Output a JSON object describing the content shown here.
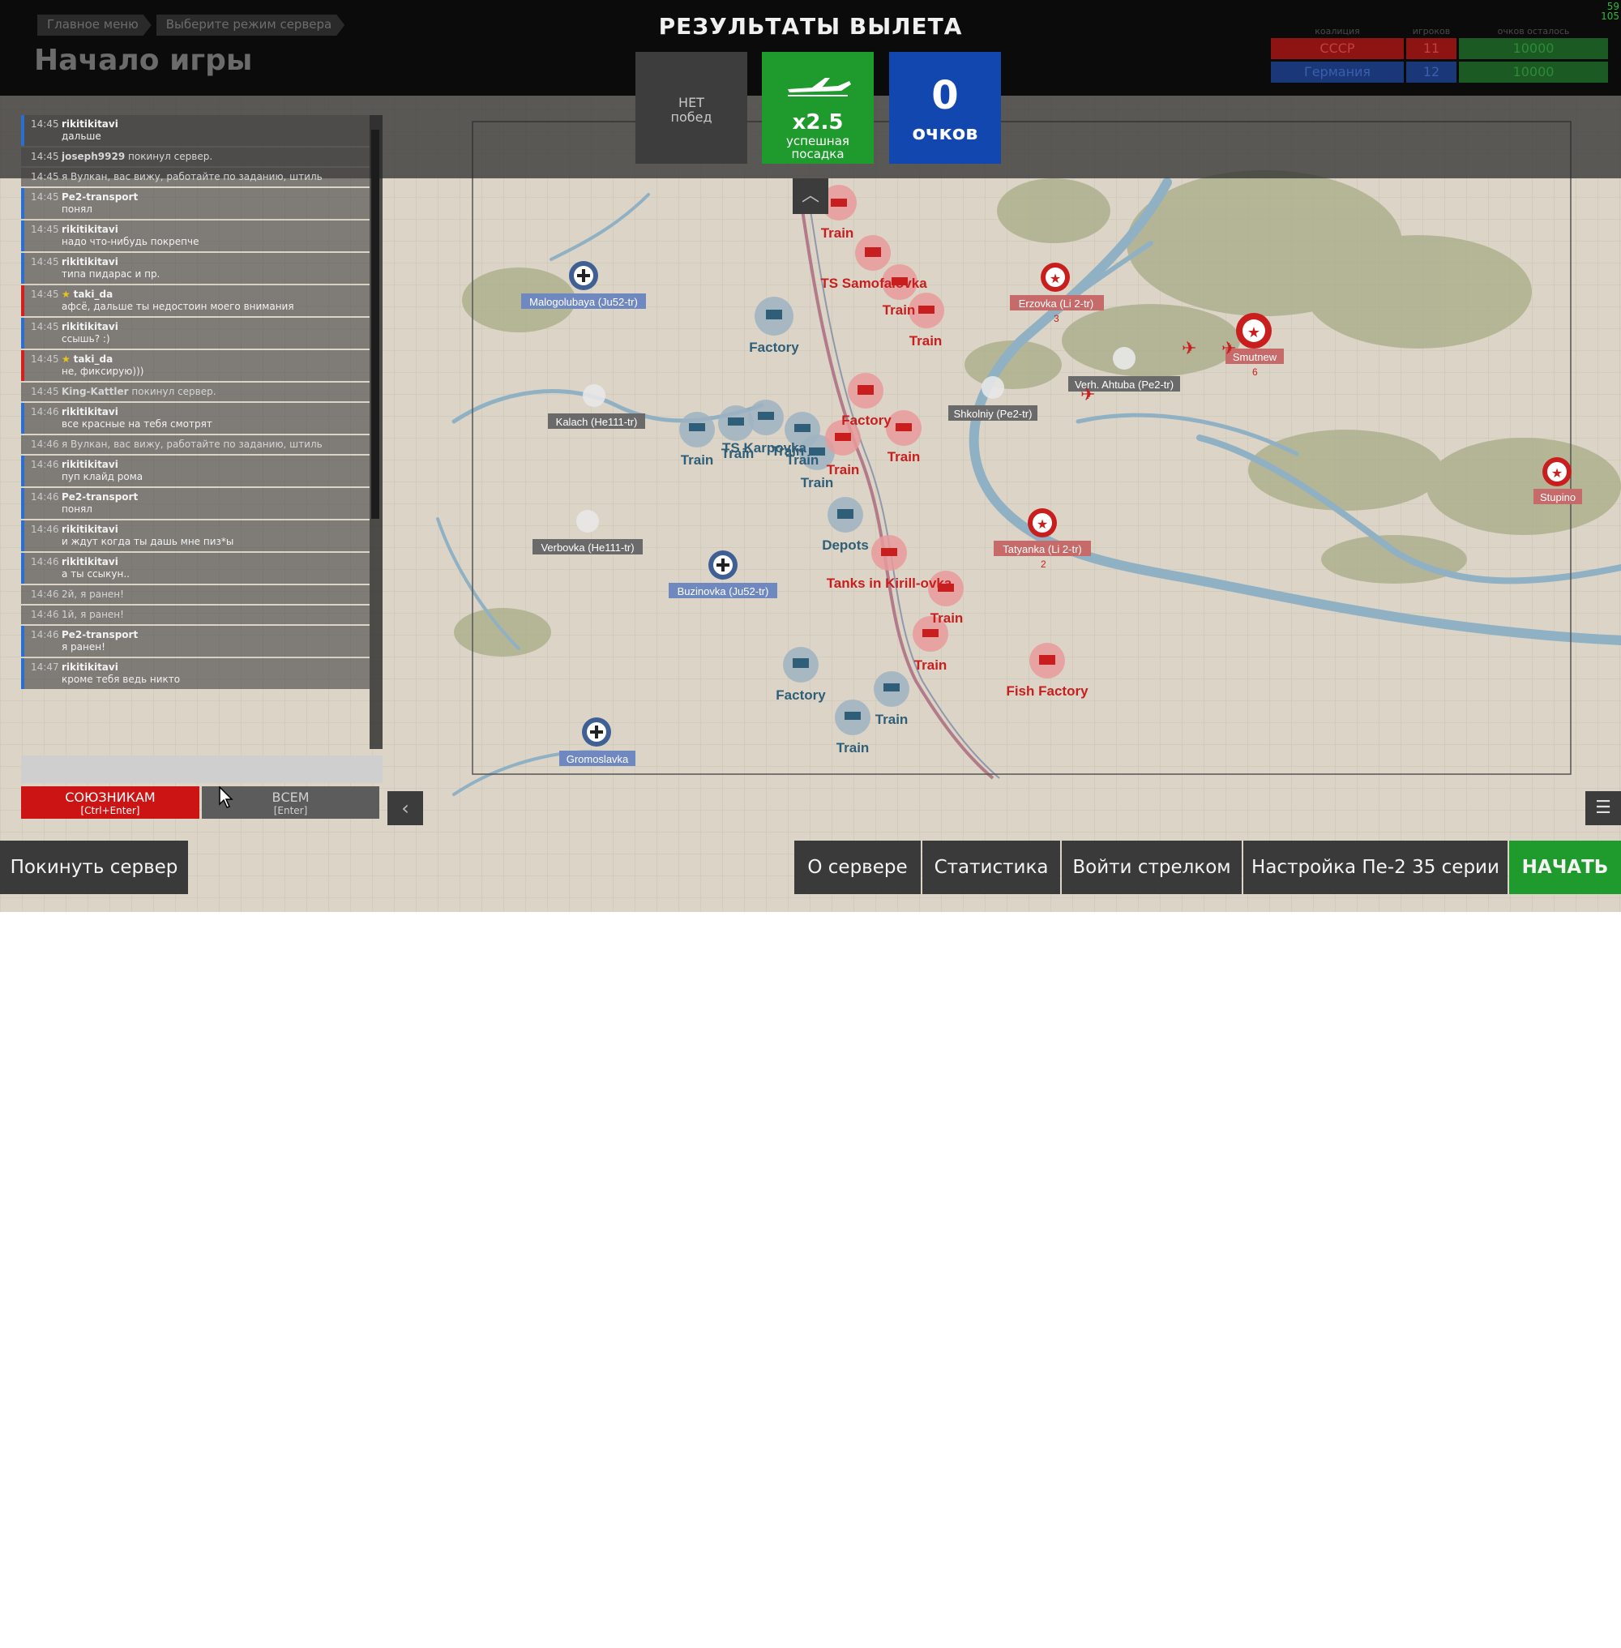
{
  "header": {
    "breadcrumbs": [
      "Главное меню",
      "Выберите режим сервера"
    ],
    "page_title": "Начало игры",
    "results_title": "РЕЗУЛЬТАТЫ ВЫЛЕТА",
    "fps": [
      "59",
      "105"
    ]
  },
  "results": {
    "wins": "НЕТ\nпобед",
    "landing_multiplier": "x2.5",
    "landing_label": "успешная\nпосадка",
    "points_value": "0",
    "points_label": "очков"
  },
  "coalitions": {
    "headers": [
      "коалиция",
      "игроков",
      "очков осталось"
    ],
    "rows": [
      {
        "name": "СССР",
        "players": "11",
        "points": "10000",
        "color": "#b01515"
      },
      {
        "name": "Германия",
        "players": "12",
        "points": "10000",
        "color": "#1f3f8f"
      }
    ]
  },
  "chat": {
    "messages": [
      {
        "time": "14:45",
        "user": "rikitikitavi",
        "text": "дальше",
        "side": "blue"
      },
      {
        "time": "14:45",
        "user": "joseph9929",
        "text": "покинул сервер.",
        "side": "sys"
      },
      {
        "time": "14:45",
        "user": "",
        "text": "я Вулкан, вас вижу, работайте по заданию, штиль",
        "side": "sys"
      },
      {
        "time": "14:45",
        "user": "Pe2-transport",
        "text": "понял",
        "side": "blue"
      },
      {
        "time": "14:45",
        "user": "rikitikitavi",
        "text": "надо что-нибудь покрепче",
        "side": "blue"
      },
      {
        "time": "14:45",
        "user": "rikitikitavi",
        "text": "типа пидарас и пр.",
        "side": "blue"
      },
      {
        "time": "14:45",
        "user": "taki_da",
        "text": "афсё, дальше ты недостоин моего внимания",
        "side": "red",
        "star": true
      },
      {
        "time": "14:45",
        "user": "rikitikitavi",
        "text": "ссышь? :)",
        "side": "blue"
      },
      {
        "time": "14:45",
        "user": "taki_da",
        "text": "не, фиксирую)))",
        "side": "red",
        "star": true
      },
      {
        "time": "14:45",
        "user": "King-Kattler",
        "text": "покинул сервер.",
        "side": "sys"
      },
      {
        "time": "14:46",
        "user": "rikitikitavi",
        "text": "все красные на тебя смотрят",
        "side": "blue"
      },
      {
        "time": "14:46",
        "user": "",
        "text": "я Вулкан, вас вижу, работайте по заданию, штиль",
        "side": "sys"
      },
      {
        "time": "14:46",
        "user": "rikitikitavi",
        "text": "пуп клайд рома",
        "side": "blue"
      },
      {
        "time": "14:46",
        "user": "Pe2-transport",
        "text": "понял",
        "side": "blue"
      },
      {
        "time": "14:46",
        "user": "rikitikitavi",
        "text": "и ждут когда ты дашь мне пиз*ы",
        "side": "blue"
      },
      {
        "time": "14:46",
        "user": "rikitikitavi",
        "text": "а ты ссыкун..",
        "side": "blue"
      },
      {
        "time": "14:46",
        "user": "",
        "text": "2й, я ранен!",
        "side": "sys"
      },
      {
        "time": "14:46",
        "user": "",
        "text": "1й, я ранен!",
        "side": "sys"
      },
      {
        "time": "14:46",
        "user": "Pe2-transport",
        "text": "я ранен!",
        "side": "blue"
      },
      {
        "time": "14:47",
        "user": "rikitikitavi",
        "text": "кроме тебя ведь никто",
        "side": "blue"
      }
    ],
    "input_value": "",
    "btn_allies": "СОЮЗНИКАМ",
    "btn_allies_hint": "[Ctrl+Enter]",
    "btn_all": "ВСЕМ",
    "btn_all_hint": "[Enter]"
  },
  "bottom": {
    "leave": "Покинуть сервер",
    "about": "О сервере",
    "stats": "Статистика",
    "gunner": "Войти стрелком",
    "setup": "Настройка Пе-2 35 серии",
    "start": "НАЧАТЬ"
  },
  "map": {
    "colors": {
      "red": "#c81e1e",
      "blue": "#2f5f78",
      "blue_tag": "#6f86bf",
      "red_tag": "#c76a6a",
      "grey_tag": "#6a6a6a"
    },
    "airfields": [
      {
        "label": "Malogolubaya (Ju52-tr)",
        "side": "blue"
      },
      {
        "label": "Kalach (He111-tr)",
        "side": "grey"
      },
      {
        "label": "Verbovka (He111-tr)",
        "side": "grey"
      },
      {
        "label": "Buzinovka (Ju52-tr)",
        "side": "blue"
      },
      {
        "label": "Gromoslavka",
        "side": "blue"
      },
      {
        "label": "Erzovka (Li 2-tr)",
        "side": "red"
      },
      {
        "label": "Shkolniy (Pe2-tr)",
        "side": "grey"
      },
      {
        "label": "Verh. Ahtuba (Pe2-tr)",
        "side": "grey"
      },
      {
        "label": "Smutnew",
        "side": "red"
      },
      {
        "label": "Tatyanka (Li 2-tr)",
        "side": "red"
      },
      {
        "label": "Stupino",
        "side": "red"
      }
    ],
    "player_counts": [
      "3",
      "6",
      "2"
    ],
    "targets_red": [
      "Train",
      "TS Samofalovka",
      "Train",
      "Train",
      "Factory",
      "Train",
      "Train",
      "Tanks in Kirill-ovka",
      "Train",
      "Train",
      "Fish Factory"
    ],
    "targets_blue": [
      "Factory",
      "Train",
      "Train",
      "TS Karpovka",
      "Train",
      "Train",
      "Train",
      "Depots",
      "Factory",
      "Train",
      "Train"
    ]
  }
}
